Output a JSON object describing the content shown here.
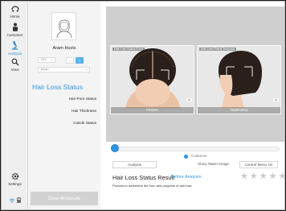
{
  "nav": {
    "home": "Home",
    "customer": "Customer",
    "analysis": "Analysis",
    "view": "View",
    "settings": "Settings"
  },
  "customer": {
    "name": "Aram Huvis",
    "age_select": "20's",
    "region_select": "Asian"
  },
  "menu": {
    "main": "Hair Loss Status",
    "items": [
      "Hair Pore Status",
      "Hair Thickness",
      "Cuticle Status"
    ]
  },
  "show_all_label": "Show All Results",
  "views": {
    "front_caption": "FRONT",
    "temporal_caption": "TEMPORAL",
    "front_tag": "Hair Loss Status Front",
    "temporal_tag": "Hair Loss Status Temporal"
  },
  "controls": {
    "radio_label": "Customer",
    "analysis_button": "Analysis",
    "taken_image_label": "Show Taken Image",
    "control_menu_button": "Control Menu On"
  },
  "result": {
    "title": "Hair Loss Status Result",
    "before_link": "Before Analysis",
    "description": "Process to determine the form and progress of hair loss.",
    "rating": 0,
    "max_rating": 5
  },
  "colors": {
    "accent": "#2f95e2",
    "rail_bg": "#efefef",
    "panel_bg": "#f4f4f4",
    "stage_bg": "#cfcfcf"
  }
}
